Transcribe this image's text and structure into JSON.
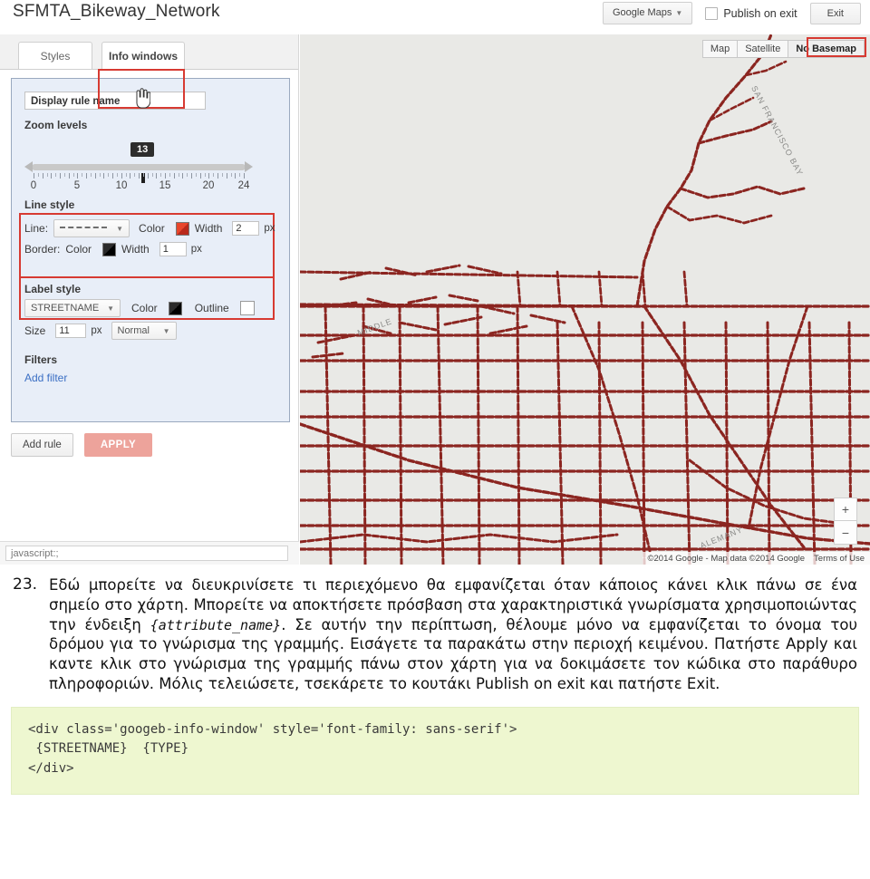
{
  "header": {
    "app_title": "SFMTA_Bikeway_Network",
    "google_maps_button": "Google Maps",
    "publish_on_exit_label": "Publish on exit",
    "exit_button": "Exit"
  },
  "tabs": [
    {
      "label": "Styles",
      "active": false
    },
    {
      "label": "Info windows",
      "active": true,
      "highlighted": true
    }
  ],
  "rule_panel": {
    "rule_name_placeholder": "Display rule name",
    "rule_name_value": "Display rule name",
    "zoom_levels": {
      "section_title": "Zoom levels",
      "tooltip_value": "13",
      "min": 0,
      "max": 24,
      "current": 13,
      "tick_labels": [
        "0",
        "5",
        "10",
        "15",
        "20",
        "24"
      ]
    },
    "line_style": {
      "section_title": "Line style",
      "line_label": "Line:",
      "line_pattern": "dashed",
      "color_label": "Color",
      "line_color": "#cc3322",
      "width_label": "Width",
      "line_width": "2",
      "unit": "px",
      "border_label": "Border:",
      "border_color_label": "Color",
      "border_color": "#111111",
      "border_width_label": "Width",
      "border_width": "1"
    },
    "label_style": {
      "section_title": "Label style",
      "field_select": "STREETNAME",
      "color_label": "Color",
      "label_color": "#111111",
      "outline_label": "Outline",
      "outline_color": "#ffffff",
      "size_label": "Size",
      "size_value": "11",
      "unit": "px",
      "weight_select": "Normal"
    },
    "filters": {
      "section_title": "Filters",
      "add_filter_link": "Add filter"
    },
    "add_rule_button": "Add rule",
    "apply_button": "APPLY"
  },
  "status_bar": {
    "value": "javascript:;"
  },
  "map": {
    "basemap_options": [
      "Map",
      "Satellite",
      "No Basemap"
    ],
    "basemap_selected": "No Basemap",
    "zoom_in": "+",
    "zoom_out": "−",
    "attribution": "©2014 Google - Map data ©2014 Google",
    "terms_link": "Terms of Use",
    "background_color": "#e9e9e6",
    "route_color": "#8b2520",
    "labels": [
      "SAN FRANCISCO BAY",
      "MIDDLE",
      "ALEMANY"
    ]
  },
  "caption": {
    "number": "23.",
    "part1": "Εδώ μπορείτε να διευκρινίσετε τι περιεχόμενο θα εμφανίζεται όταν κάποιος κάνει κλικ πάνω σε ένα σημείο στο χάρτη. Μπορείτε να αποκτήσετε πρόσβαση στα χαρακτηριστικά γνωρίσματα χρησιμοποιώντας την ένδειξη ",
    "mono": "{attribute_name}",
    "part2": ". Σε αυτήν την περίπτωση, θέλουμε μόνο να εμφανίζεται το όνομα του δρόμου για το γνώρισμα της γραμμής. Εισάγετε τα παρακάτω στην περιοχή κειμένου. Πατήστε Apply και καντε κλικ στο γνώρισμα της γραμμής πάνω στον χάρτη για να δοκιμάσετε τον κώδικα στο παράθυρο πληροφοριών. Μόλις τελειώσετε, τσεκάρετε το κουτάκι Publish on exit και πατήστε Exit."
  },
  "code_block": {
    "content": "<div class='googeb-info-window' style='font-family: sans-serif'>\n {STREETNAME}  {TYPE}\n</div>"
  }
}
